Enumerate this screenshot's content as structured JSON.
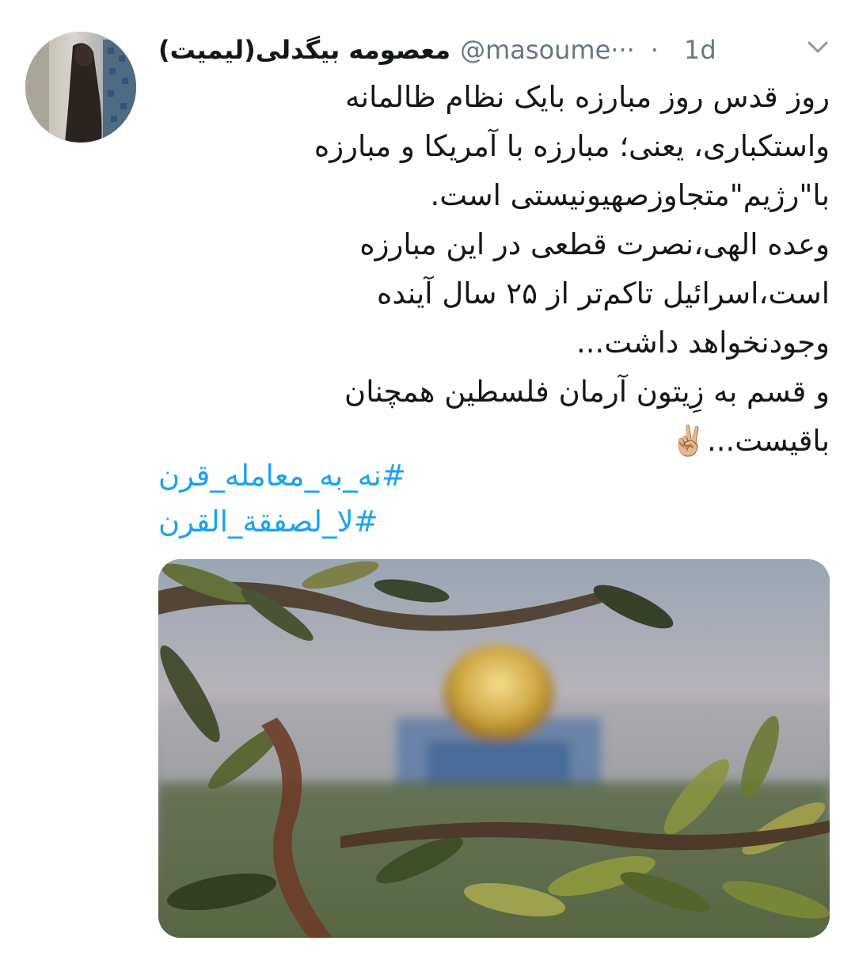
{
  "tweet": {
    "author": {
      "display_name": "معصومه بیگدلی(لیمیت)",
      "handle": "@masoume···",
      "avatar_icon": "avatar-photo"
    },
    "separator": "·",
    "time": "1d",
    "menu_icon": "chevron-down-icon",
    "text_lines": [
      "روز قدس روز مبارزه بایک نظام ظالمانه",
      "واستکباری، یعنی؛ مبارزه با آمریکا و مبارزه",
      "با\"رژیم\"متجاوزصهیونیستی است.",
      "وعده الهی،نصرت قطعی در این مبارزه",
      "است،اسرائیل تاکم‌تر از ۲۵ سال آینده",
      "وجودنخواهد داشت...",
      "و قسم به زِیتون آرمان فلسطین همچنان",
      "باقیست...✌🏼"
    ],
    "hashtags": [
      "#نه_به_معامله_قرن",
      "#لا_لصفقة_القرن"
    ],
    "media_description_icon": "photo-olive-branches-dome",
    "colors": {
      "text": "#14171a",
      "secondary": "#657786",
      "link": "#1da1f2"
    }
  }
}
